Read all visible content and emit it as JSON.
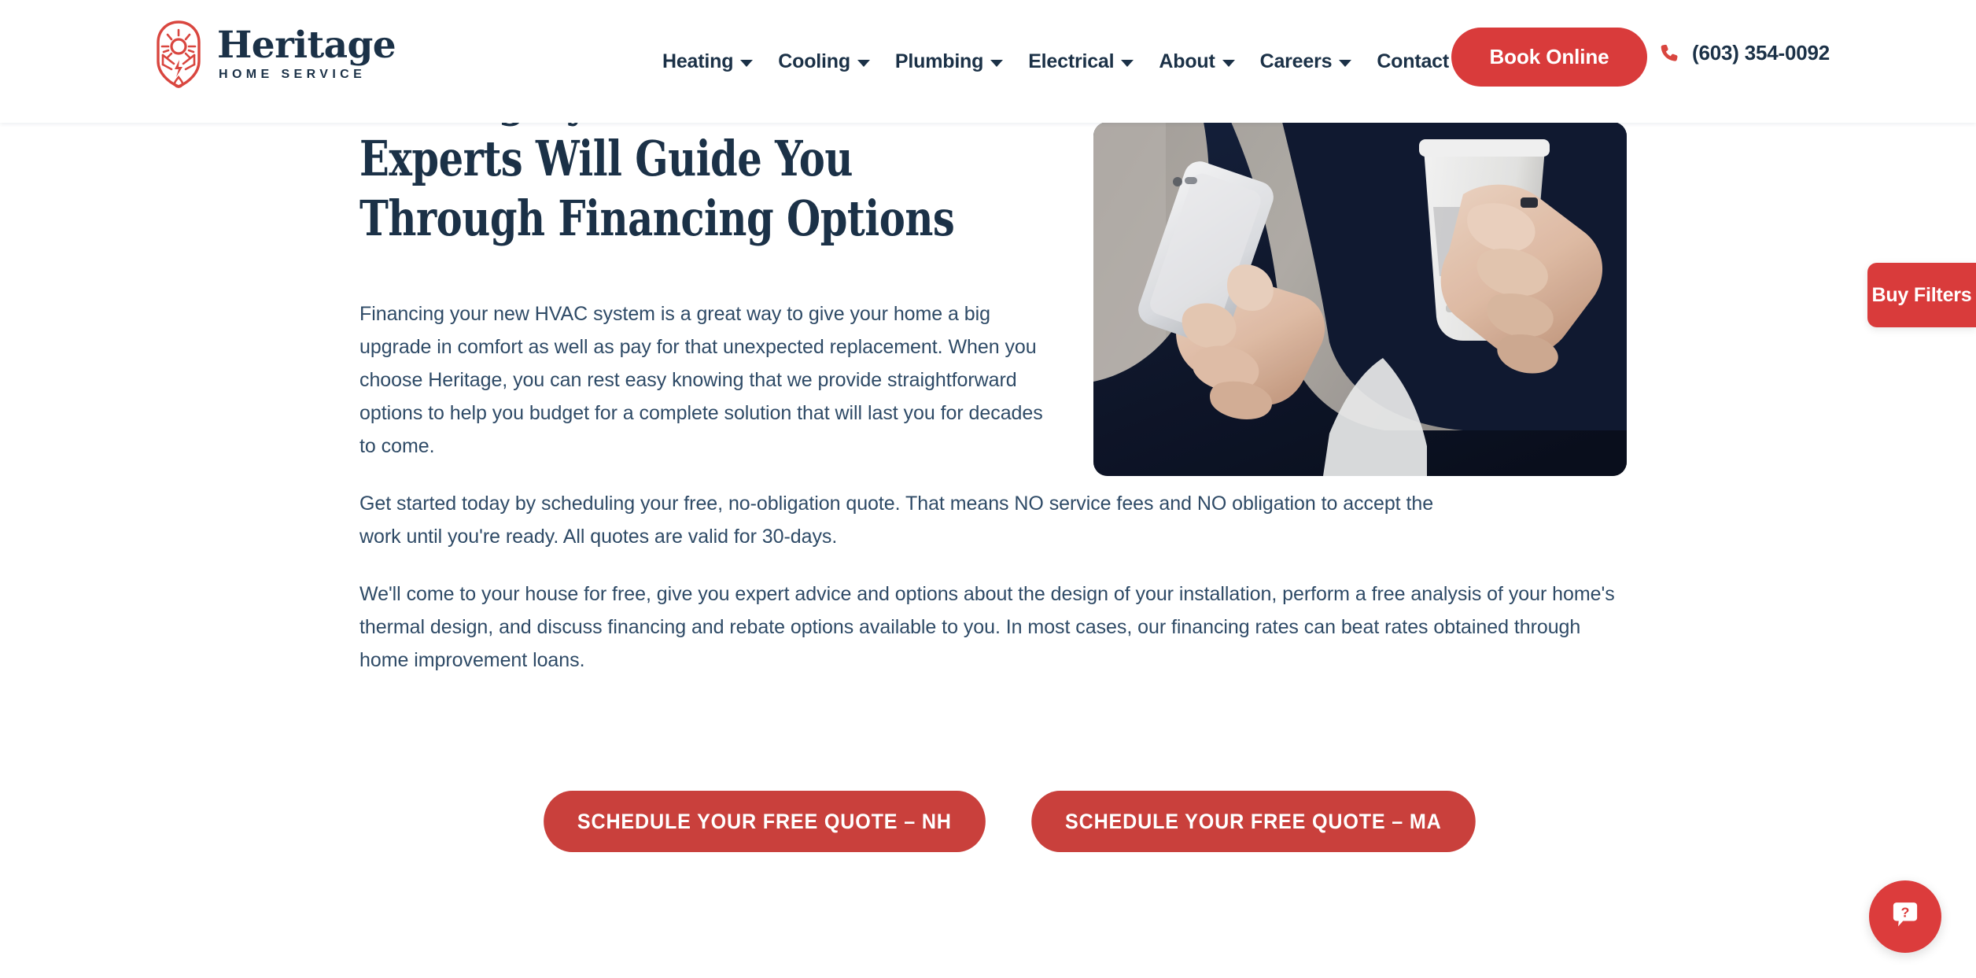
{
  "brand": {
    "name": "Heritage",
    "tagline": "HOME SERVICE",
    "logo_icon": "sun-lightning-waterdrop-shield-icon",
    "accent_red": "#D93B3B",
    "navy": "#1B3147",
    "body_text_color": "#2E4A66",
    "cta_red": "#C9403C"
  },
  "header": {
    "nav": [
      {
        "label": "Heating",
        "has_dropdown": true
      },
      {
        "label": "Cooling",
        "has_dropdown": true
      },
      {
        "label": "Plumbing",
        "has_dropdown": true
      },
      {
        "label": "Electrical",
        "has_dropdown": true
      },
      {
        "label": "About",
        "has_dropdown": true
      },
      {
        "label": "Careers",
        "has_dropdown": true
      },
      {
        "label": "Contact",
        "has_dropdown": true
      }
    ],
    "book_button": "Book Online",
    "phone": "(603) 354-0092",
    "phone_icon": "phone-handset-icon"
  },
  "hero": {
    "heading_lines": [
      "Cooling System? Our Comfort",
      "Experts Will Guide You",
      "Through Financing Options"
    ],
    "image_alt": "Person holding a white smartphone in one hand and a white coffee cup in the other, wearing a dark navy sweater"
  },
  "body": {
    "paragraphs": [
      "Financing your new HVAC system is a great way to give your home a big upgrade in comfort as well as pay for that unexpected replacement. When you choose Heritage, you can rest easy knowing that we provide straightforward options to help you budget for a complete solution that will last you for decades to come.",
      "Get started today by scheduling your free, no-obligation quote.  That means NO service fees and NO obligation to accept the work until you're ready.  All quotes are valid for 30-days.",
      "We'll come to your house for free, give you expert advice and options about the design of your installation, perform a free analysis of your home's thermal design, and discuss financing and rebate options available to you.  In most cases, our financing rates can beat rates obtained through home improvement loans."
    ]
  },
  "cta": {
    "buttons": [
      {
        "label": "SCHEDULE YOUR FREE QUOTE – NH"
      },
      {
        "label": "SCHEDULE YOUR FREE QUOTE – MA"
      }
    ]
  },
  "widgets": {
    "side_tab_label": "Buy Filters",
    "chat_icon": "question-speech-bubble-icon"
  }
}
